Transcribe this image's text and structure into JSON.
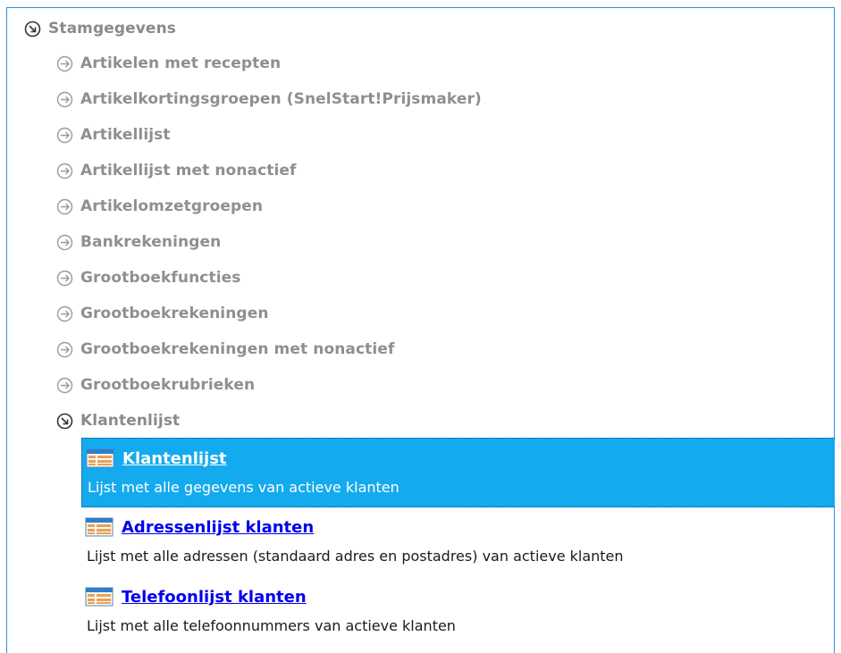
{
  "tree": {
    "root": {
      "label": "Stamgegevens",
      "state": "expanded",
      "icon": "circle-arrow-down-right-icon"
    },
    "items": [
      {
        "label": "Artikelen met recepten",
        "state": "collapsed",
        "icon": "circle-arrow-right-icon"
      },
      {
        "label": "Artikelkortingsgroepen (SnelStart!Prijsmaker)",
        "state": "collapsed",
        "icon": "circle-arrow-right-icon"
      },
      {
        "label": "Artikellijst",
        "state": "collapsed",
        "icon": "circle-arrow-right-icon"
      },
      {
        "label": "Artikellijst met nonactief",
        "state": "collapsed",
        "icon": "circle-arrow-right-icon"
      },
      {
        "label": "Artikelomzetgroepen",
        "state": "collapsed",
        "icon": "circle-arrow-right-icon"
      },
      {
        "label": "Bankrekeningen",
        "state": "collapsed",
        "icon": "circle-arrow-right-icon"
      },
      {
        "label": "Grootboekfuncties",
        "state": "collapsed",
        "icon": "circle-arrow-right-icon"
      },
      {
        "label": "Grootboekrekeningen",
        "state": "collapsed",
        "icon": "circle-arrow-right-icon"
      },
      {
        "label": "Grootboekrekeningen met nonactief",
        "state": "collapsed",
        "icon": "circle-arrow-right-icon"
      },
      {
        "label": "Grootboekrubrieken",
        "state": "collapsed",
        "icon": "circle-arrow-right-icon"
      },
      {
        "label": "Klantenlijst",
        "state": "expanded",
        "icon": "circle-arrow-down-right-icon"
      }
    ]
  },
  "reports": [
    {
      "title": "Klantenlijst",
      "description": "Lijst met alle gegevens van actieve klanten",
      "selected": true,
      "icon": "report-table-icon"
    },
    {
      "title": "Adressenlijst klanten",
      "description": "Lijst met alle adressen (standaard adres en postadres) van actieve klanten",
      "selected": false,
      "icon": "report-table-icon"
    },
    {
      "title": "Telefoonlijst klanten",
      "description": "Lijst met alle telefoonnummers van actieve klanten",
      "selected": false,
      "icon": "report-table-icon"
    }
  ],
  "colors": {
    "border": "#2d8fdc",
    "selection": "#14aaee",
    "link": "#0000ee",
    "tree_text": "#8f8f8f"
  }
}
